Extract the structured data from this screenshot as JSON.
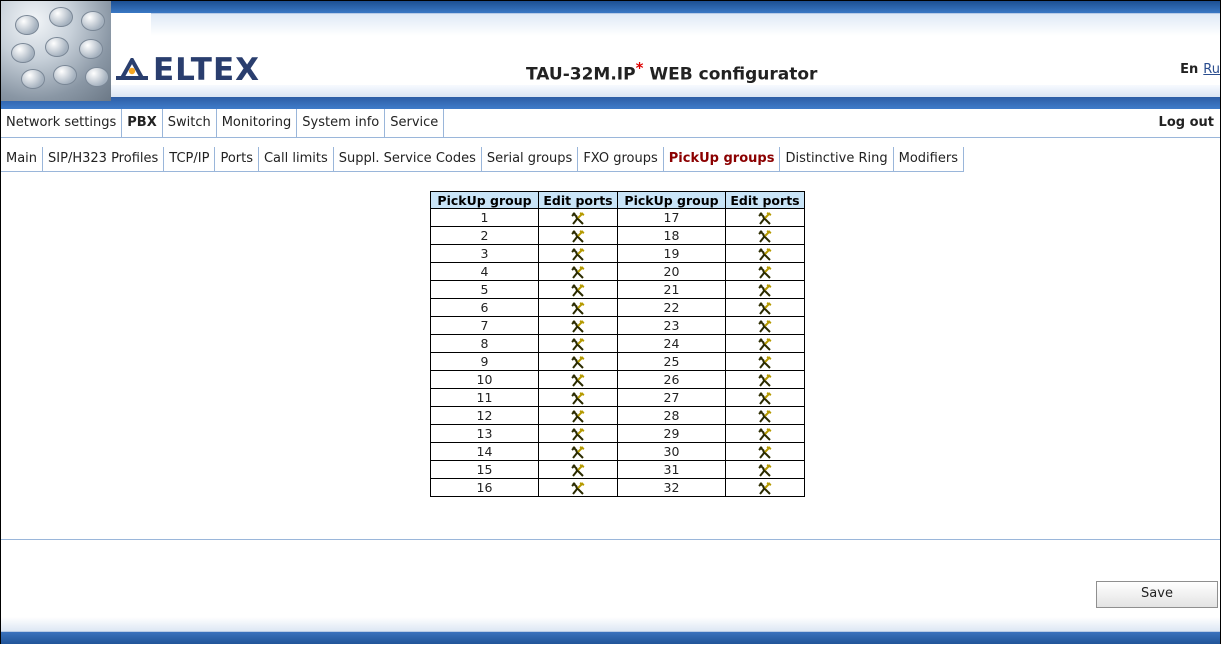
{
  "header": {
    "logo_text": "ELTEX",
    "title_main": "TAU-32M.IP",
    "title_star": "*",
    "title_suffix": " WEB configurator",
    "lang_en": "En",
    "lang_ru": "Ru",
    "brand_color": "#2a3e6e",
    "logo_accent": "#f5a623"
  },
  "main_menu": {
    "items": [
      "Network settings",
      "PBX",
      "Switch",
      "Monitoring",
      "System info",
      "Service"
    ],
    "active": "PBX",
    "logout": "Log out"
  },
  "sub_menu": {
    "items": [
      "Main",
      "SIP/H323 Profiles",
      "TCP/IP",
      "Ports",
      "Call limits",
      "Suppl. Service Codes",
      "Serial groups",
      "FXO groups",
      "PickUp groups",
      "Distinctive Ring",
      "Modifiers"
    ],
    "active": "PickUp groups",
    "active_color": "#8b0000"
  },
  "table": {
    "headers": [
      "PickUp group",
      "Edit ports",
      "PickUp group",
      "Edit ports"
    ],
    "header_bg": "#c9e4f7",
    "rows": [
      [
        "1",
        "17"
      ],
      [
        "2",
        "18"
      ],
      [
        "3",
        "19"
      ],
      [
        "4",
        "20"
      ],
      [
        "5",
        "21"
      ],
      [
        "6",
        "22"
      ],
      [
        "7",
        "23"
      ],
      [
        "8",
        "24"
      ],
      [
        "9",
        "25"
      ],
      [
        "10",
        "26"
      ],
      [
        "11",
        "27"
      ],
      [
        "12",
        "28"
      ],
      [
        "13",
        "29"
      ],
      [
        "14",
        "30"
      ],
      [
        "15",
        "31"
      ],
      [
        "16",
        "32"
      ]
    ],
    "edit_icon": "tools-icon"
  },
  "save_label": "Save"
}
